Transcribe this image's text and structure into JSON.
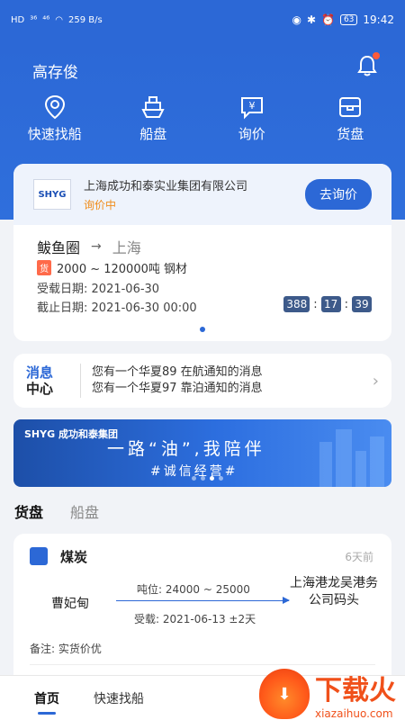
{
  "status_bar": {
    "left_indicators": [
      "HD",
      "³⁶",
      "⁴⁶",
      "wifi",
      "259 B/s"
    ],
    "time": "19:42",
    "battery": "63"
  },
  "header": {
    "user_name": "高存俊"
  },
  "nav": [
    {
      "label": "快速找船",
      "icon": "location-pin-icon"
    },
    {
      "label": "船盘",
      "icon": "ship-icon"
    },
    {
      "label": "询价",
      "icon": "yen-chat-icon"
    },
    {
      "label": "货盘",
      "icon": "cargo-box-icon"
    }
  ],
  "inquiry": {
    "logo_text": "SHYG",
    "company": "上海成功和泰实业集团有限公司",
    "status": "询价中",
    "button": "去询价",
    "from": "鲅鱼圈",
    "to": "上海",
    "arrow": "→",
    "cargo_tag": "货",
    "cargo": "2000 ~ 120000吨 钢材",
    "load_date_label": "受载日期:",
    "load_date": "2021-06-30",
    "deadline_label": "截止日期:",
    "deadline": "2021-06-30 00:00",
    "countdown": [
      "388",
      "17",
      "39"
    ]
  },
  "messages": {
    "logo_line1": "消息",
    "logo_line2": "中心",
    "items": [
      "您有一个华夏89 在航通知的消息",
      "您有一个华夏97 靠泊通知的消息"
    ]
  },
  "banner": {
    "logo": "SHYG 成功和泰集团",
    "main": "一路“油”,我陪伴",
    "sub": "#诚信经营#"
  },
  "tabs": [
    "货盘",
    "船盘"
  ],
  "cargo_card": {
    "name": "煤炭",
    "time_ago": "6天前",
    "from": "曹妃甸",
    "tonnage": "吨位: 24000 ~ 25000",
    "load": "受载: 2021-06-13 ±2天",
    "to": "上海港龙吴港务公司码头",
    "note": "备注: 实货价优"
  },
  "bottom_nav": [
    "首页",
    "快速找船"
  ],
  "watermark": {
    "text": "下载火",
    "url": "xiazaihuo.com"
  },
  "colors": {
    "primary": "#2c68d6",
    "accent_orange": "#f08c1a",
    "tag_red": "#ff6a4a"
  }
}
